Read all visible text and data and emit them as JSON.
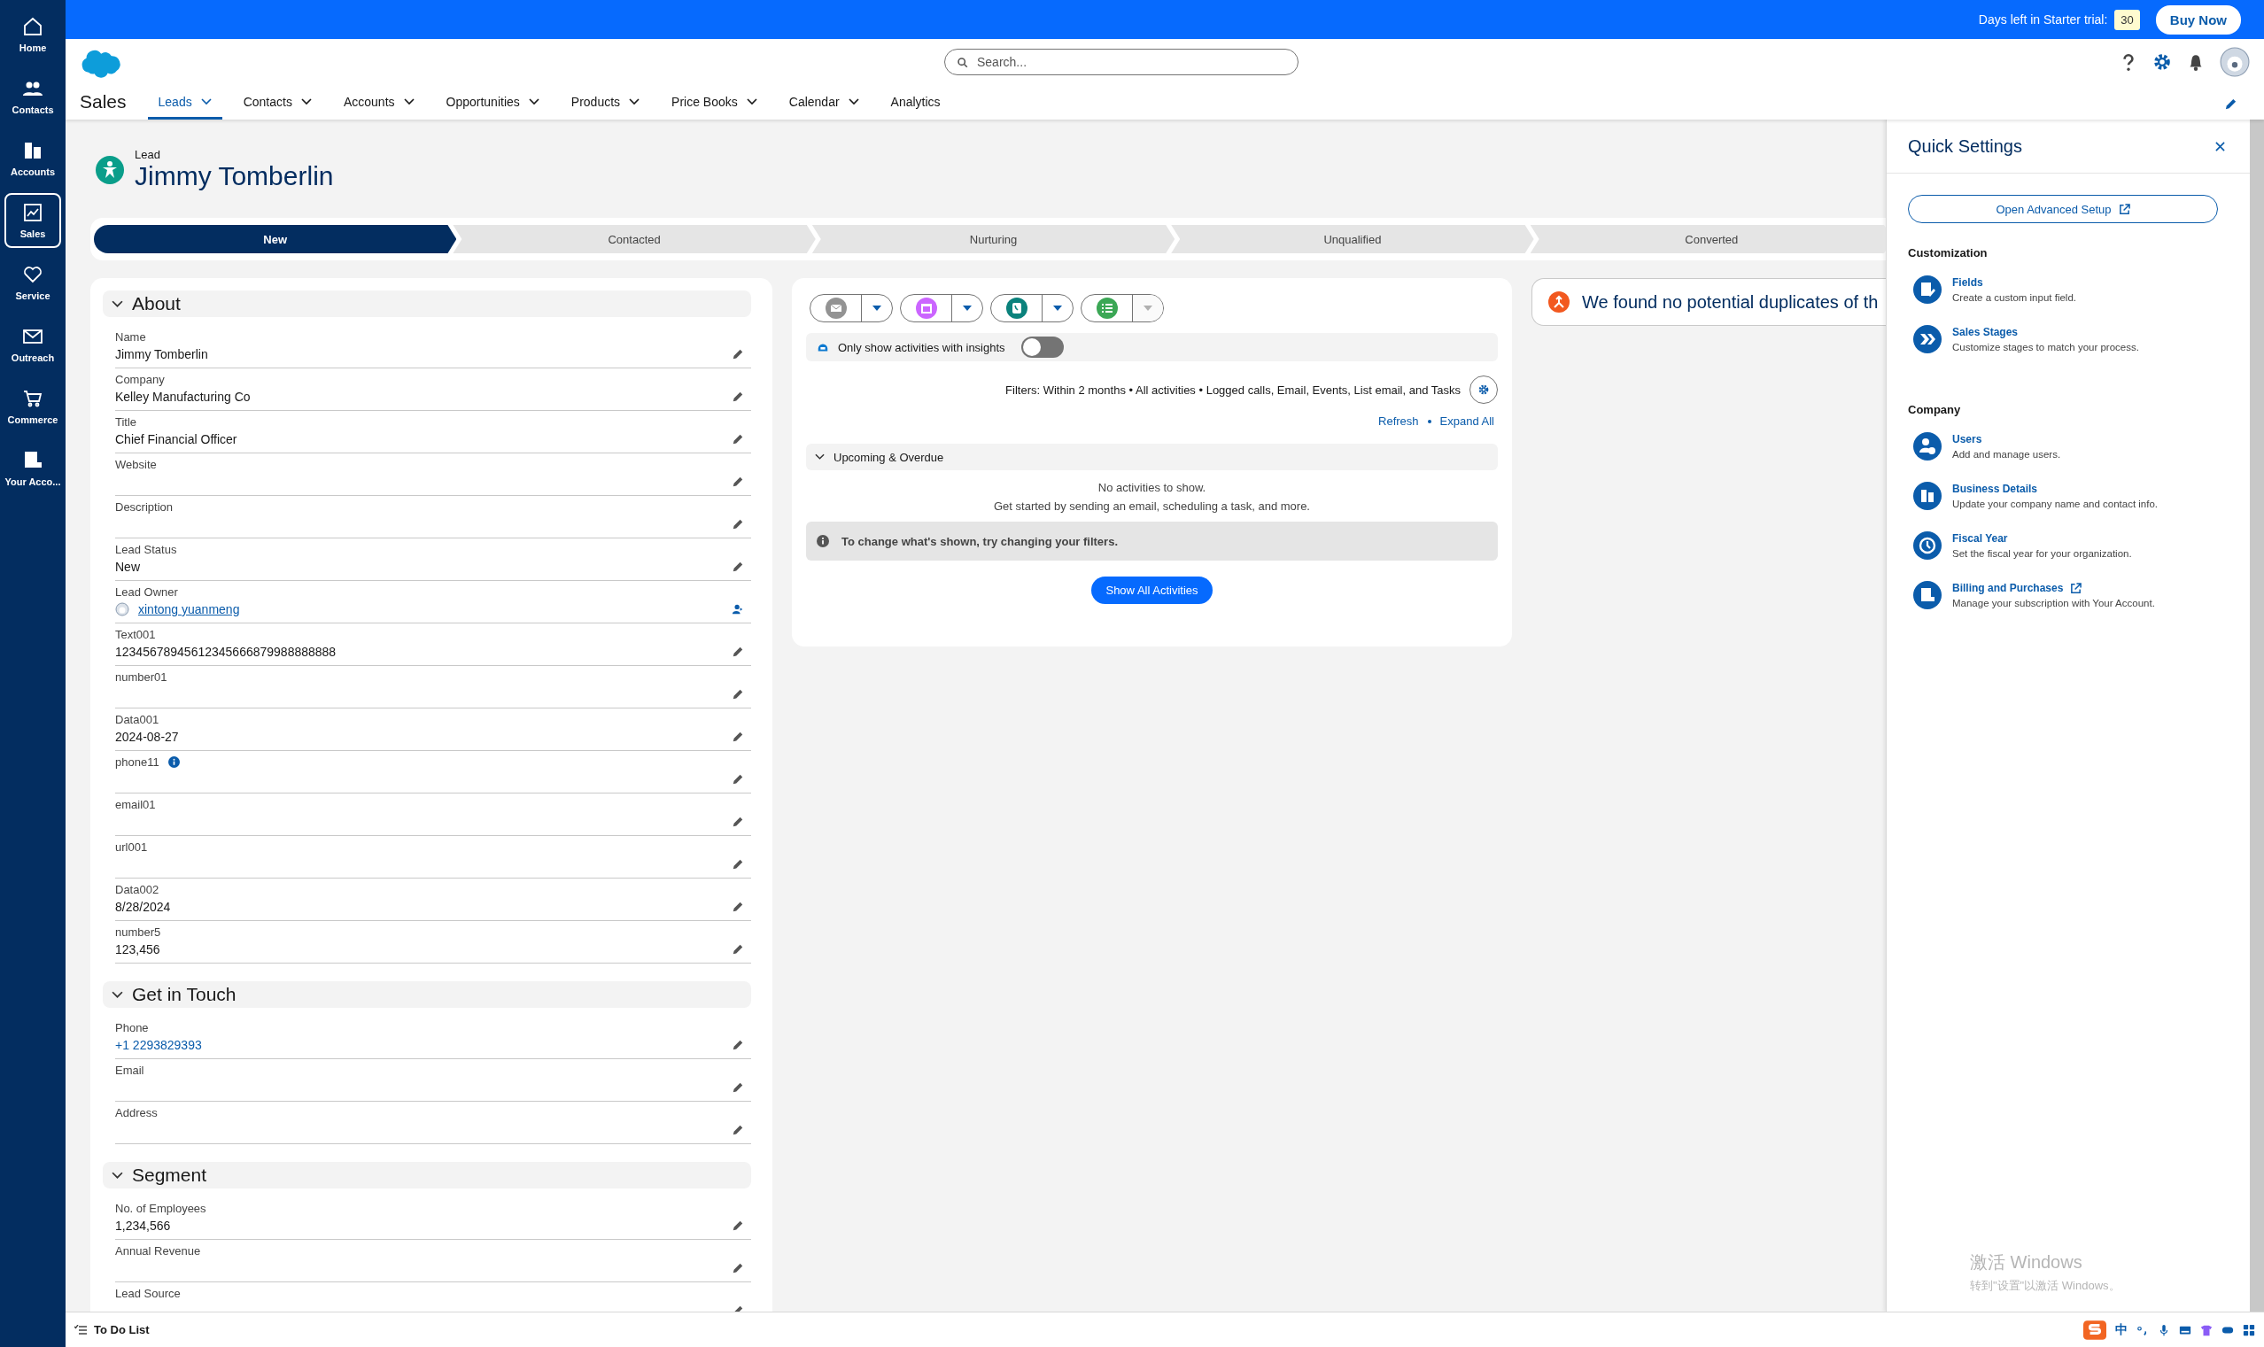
{
  "top_bar": {
    "trial_label": "Days left in Starter trial:",
    "trial_days": "30",
    "buy_button": "Buy Now"
  },
  "sidebar": {
    "items": [
      {
        "label": "Home",
        "kind": "home",
        "selected": false
      },
      {
        "label": "Contacts",
        "kind": "people",
        "selected": false
      },
      {
        "label": "Accounts",
        "kind": "building",
        "selected": false
      },
      {
        "label": "Sales",
        "kind": "chart",
        "selected": true
      },
      {
        "label": "Service",
        "kind": "heart",
        "selected": false
      },
      {
        "label": "Outreach",
        "kind": "mail",
        "selected": false
      },
      {
        "label": "Commerce",
        "kind": "cart",
        "selected": false
      },
      {
        "label": "Your Acco...",
        "kind": "account",
        "selected": false
      }
    ]
  },
  "header": {
    "search": {
      "placeholder": "Search..."
    },
    "app_name": "Sales",
    "tabs": [
      {
        "label": "Leads",
        "dropdown": true,
        "selected": true
      },
      {
        "label": "Contacts",
        "dropdown": true,
        "selected": false
      },
      {
        "label": "Accounts",
        "dropdown": true,
        "selected": false
      },
      {
        "label": "Opportunities",
        "dropdown": true,
        "selected": false
      },
      {
        "label": "Products",
        "dropdown": true,
        "selected": false
      },
      {
        "label": "Price Books",
        "dropdown": true,
        "selected": false
      },
      {
        "label": "Calendar",
        "dropdown": true,
        "selected": false
      },
      {
        "label": "Analytics",
        "dropdown": false,
        "selected": false
      }
    ]
  },
  "record": {
    "type": "Lead",
    "name": "Jimmy Tomberlin"
  },
  "path": [
    {
      "label": "New",
      "selected": true
    },
    {
      "label": "Contacted",
      "selected": false
    },
    {
      "label": "Nurturing",
      "selected": false
    },
    {
      "label": "Unqualified",
      "selected": false
    },
    {
      "label": "Converted",
      "selected": false
    }
  ],
  "sections": [
    {
      "title": "About",
      "fields": [
        {
          "label": "Name",
          "value": "Jimmy Tomberlin",
          "kind": "text"
        },
        {
          "label": "Company",
          "value": "Kelley Manufacturing Co",
          "kind": "text"
        },
        {
          "label": "Title",
          "value": "Chief Financial Officer",
          "kind": "text"
        },
        {
          "label": "Website",
          "kind": "text"
        },
        {
          "label": "Description",
          "kind": "text"
        },
        {
          "label": "Lead Status",
          "value": "New",
          "kind": "text"
        },
        {
          "label": "Lead Owner",
          "value": "xintong yuanmeng",
          "kind": "owner"
        },
        {
          "label": "Text001",
          "value": "12345678945612345666879988888888",
          "kind": "text"
        },
        {
          "label": "number01",
          "kind": "text"
        },
        {
          "label": "Data001",
          "value": "2024-08-27",
          "kind": "text"
        },
        {
          "label": "phone11",
          "kind": "text",
          "info": true
        },
        {
          "label": "email01",
          "kind": "text"
        },
        {
          "label": "url001",
          "kind": "text"
        },
        {
          "label": "Data002",
          "value": "8/28/2024",
          "kind": "text"
        },
        {
          "label": "number5",
          "value": "123,456",
          "kind": "text"
        }
      ]
    },
    {
      "title": "Get in Touch",
      "fields": [
        {
          "label": "Phone",
          "value": "+1 2293829393",
          "kind": "link"
        },
        {
          "label": "Email",
          "kind": "text"
        },
        {
          "label": "Address",
          "kind": "text"
        }
      ]
    },
    {
      "title": "Segment",
      "fields": [
        {
          "label": "No. of Employees",
          "value": "1,234,566",
          "kind": "text"
        },
        {
          "label": "Annual Revenue",
          "kind": "text"
        },
        {
          "label": "Lead Source",
          "kind": "text"
        }
      ]
    }
  ],
  "activity": {
    "actions": [
      {
        "kind": "email",
        "disabled": false
      },
      {
        "kind": "event",
        "disabled": false
      },
      {
        "kind": "call",
        "disabled": false
      },
      {
        "kind": "task",
        "disabled": true
      }
    ],
    "insights_toggle": {
      "label": "Only show activities with insights",
      "on": false
    },
    "filters": "Filters: Within 2 months • All activities • Logged calls, Email, Events, List email, and Tasks",
    "links": [
      "Refresh",
      "Expand All"
    ],
    "group": "Upcoming & Overdue",
    "empty_title": "No activities to show.",
    "empty_hint": "Get started by sending an email, scheduling a task, and more.",
    "notice": "To change what's shown, try changing your filters.",
    "show_all_button": "Show All Activities"
  },
  "duplicates": {
    "message": "We found no potential duplicates of th"
  },
  "quick_settings": {
    "title": "Quick Settings",
    "advanced_button": "Open Advanced Setup",
    "groups": [
      {
        "title": "Customization",
        "items": [
          {
            "title": "Fields",
            "description": "Create a custom input field.",
            "kind": "fields",
            "external": false
          },
          {
            "title": "Sales Stages",
            "description": "Customize stages to match your process.",
            "kind": "stages",
            "external": false
          }
        ]
      },
      {
        "title": "Company",
        "items": [
          {
            "title": "Users",
            "description": "Add and manage users.",
            "kind": "users",
            "external": false
          },
          {
            "title": "Business Details",
            "description": "Update your company name and contact info.",
            "kind": "building",
            "external": false
          },
          {
            "title": "Fiscal Year",
            "description": "Set the fiscal year for your organization.",
            "kind": "clock",
            "external": false
          },
          {
            "title": "Billing and Purchases",
            "description": "Manage your subscription with Your Account.",
            "kind": "billing",
            "external": true
          }
        ]
      }
    ]
  },
  "os_notice": {
    "title": "激活 Windows",
    "hint": "转到\"设置\"以激活 Windows。"
  },
  "bottom_bar": {
    "utility": "To Do List",
    "ime_mode": "中"
  }
}
